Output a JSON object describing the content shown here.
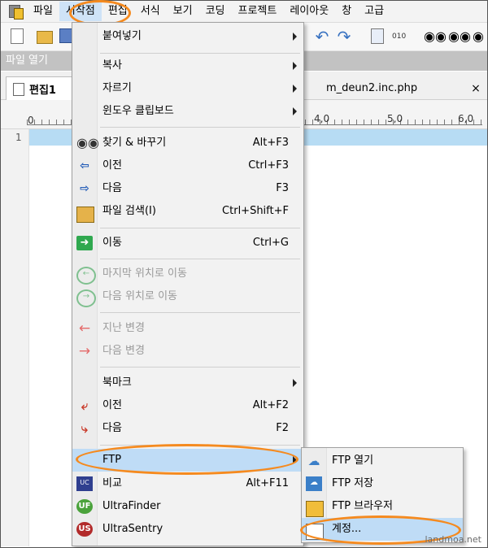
{
  "menubar": {
    "items": [
      "파일",
      "시작점",
      "편집",
      "서식",
      "보기",
      "코딩",
      "프로젝트",
      "레이아웃",
      "창",
      "고급"
    ]
  },
  "pane_header": "파일 열기",
  "tabs": {
    "active": "편집1",
    "other": "m_deun2.inc.php",
    "close_glyph": "×"
  },
  "ruler": {
    "labels": [
      "0",
      "4,0",
      "5,0",
      "6,0"
    ]
  },
  "editor": {
    "line_number": "1"
  },
  "dropdown": {
    "items": [
      {
        "label": "붙여넣기",
        "shortcut": "",
        "submenu": true
      },
      {
        "label": "복사",
        "shortcut": "",
        "submenu": true
      },
      {
        "label": "자르기",
        "shortcut": "",
        "submenu": true
      },
      {
        "label": "윈도우 클립보드",
        "shortcut": "",
        "submenu": true
      },
      {
        "label": "찾기 & 바꾸기",
        "shortcut": "Alt+F3",
        "icon": "binoculars-icon"
      },
      {
        "label": "이전",
        "shortcut": "Ctrl+F3",
        "icon": "find-prev-icon"
      },
      {
        "label": "다음",
        "shortcut": "F3",
        "icon": "find-next-icon"
      },
      {
        "label": "파일 검색(I)",
        "shortcut": "Ctrl+Shift+F",
        "icon": "folder-search-icon"
      },
      {
        "label": "이동",
        "shortcut": "Ctrl+G",
        "icon": "goto-icon"
      },
      {
        "label": "마지막 위치로 이동",
        "shortcut": "",
        "icon": "back-circle-icon",
        "disabled": true
      },
      {
        "label": "다음 위치로 이동",
        "shortcut": "",
        "icon": "forward-circle-icon",
        "disabled": true
      },
      {
        "label": "지난 변경",
        "shortcut": "",
        "icon": "arrow-left-icon",
        "disabled": true
      },
      {
        "label": "다음 변경",
        "shortcut": "",
        "icon": "arrow-right-icon",
        "disabled": true
      },
      {
        "label": "북마크",
        "shortcut": "",
        "submenu": true
      },
      {
        "label": "이전",
        "shortcut": "Alt+F2",
        "icon": "bookmark-prev-icon"
      },
      {
        "label": "다음",
        "shortcut": "F2",
        "icon": "bookmark-next-icon"
      },
      {
        "label": "FTP",
        "shortcut": "",
        "submenu": true,
        "highlighted": true
      },
      {
        "label": "비교",
        "shortcut": "Alt+F11",
        "icon": "compare-icon"
      },
      {
        "label": "UltraFinder",
        "shortcut": "",
        "icon": "ultrafinder-icon"
      },
      {
        "label": "UltraSentry",
        "shortcut": "",
        "icon": "ultrasentry-icon"
      }
    ]
  },
  "ftp_submenu": {
    "items": [
      {
        "label": "FTP 열기",
        "icon": "ftp-open-icon"
      },
      {
        "label": "FTP 저장",
        "icon": "ftp-save-icon"
      },
      {
        "label": "FTP 브라우저",
        "icon": "ftp-browser-icon"
      },
      {
        "label": "계정...",
        "icon": "account-icon",
        "highlighted": true
      }
    ]
  },
  "colors": {
    "highlight_oval": "#f58a1f",
    "menu_hover": "#bfdcf6",
    "current_line": "#b7dcf4"
  },
  "watermark": "landmoa.net"
}
